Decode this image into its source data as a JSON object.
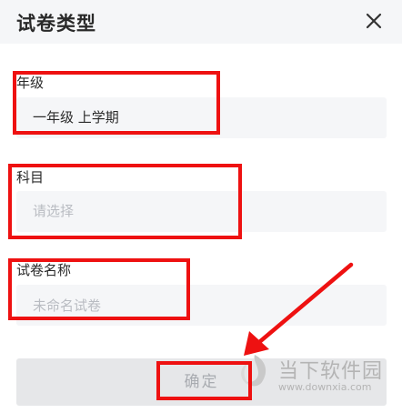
{
  "dialog": {
    "title": "试卷类型",
    "close_icon": "close-icon"
  },
  "fields": {
    "grade": {
      "label": "年级",
      "value": "一年级 上学期"
    },
    "subject": {
      "label": "科目",
      "placeholder": "请选择"
    },
    "paper_name": {
      "label": "试卷名称",
      "placeholder": "未命名试卷"
    }
  },
  "confirm": {
    "label": "确定",
    "state": "disabled"
  },
  "watermark": {
    "name": "当下软件园",
    "url": "www.downxia.com",
    "logo_icon": "downxia-logo-icon"
  },
  "annotations": {
    "box_color": "#ee1111",
    "arrow_color": "#ee1111"
  },
  "colors": {
    "header_bg": "#f5f6f8",
    "field_bg": "#f5f6f8",
    "button_bg": "#e6e7e9",
    "placeholder": "#b9bcc2"
  }
}
